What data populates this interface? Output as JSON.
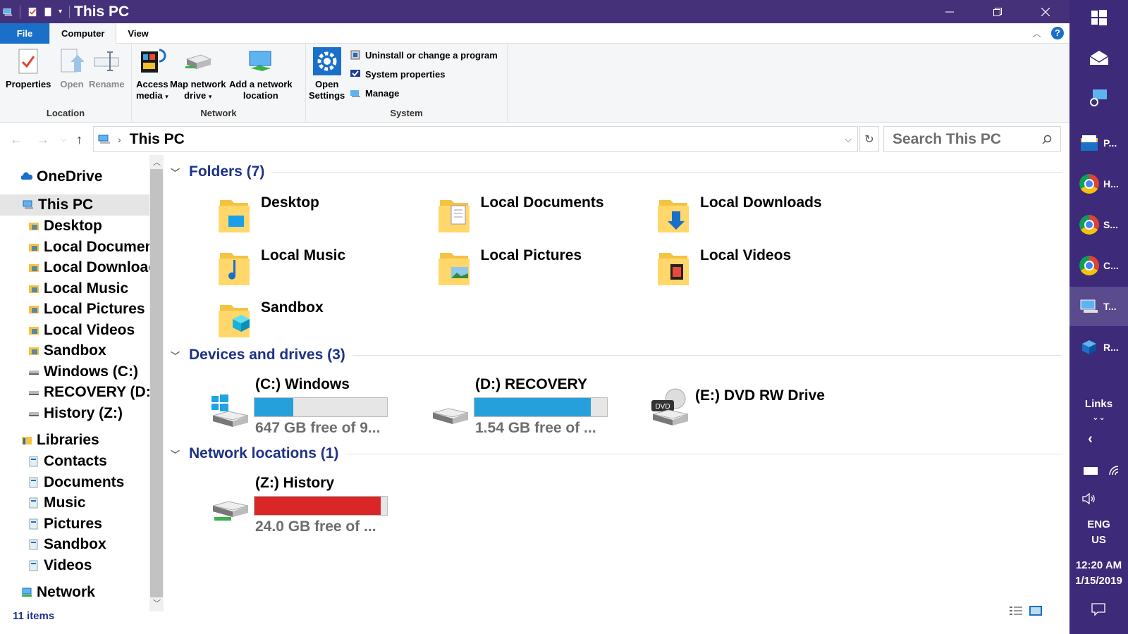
{
  "window": {
    "title": "This PC",
    "status_items": "11 items"
  },
  "ribbon_tabs": [
    "File",
    "Computer",
    "View"
  ],
  "ribbon": {
    "location": {
      "label": "Location",
      "buttons": [
        "Properties",
        "Open",
        "Rename"
      ]
    },
    "network": {
      "label": "Network",
      "access_media": [
        "Access",
        "media"
      ],
      "map_drive": [
        "Map network",
        "drive"
      ],
      "add_location": [
        "Add a network",
        "location"
      ]
    },
    "system": {
      "label": "System",
      "open_settings": [
        "Open",
        "Settings"
      ],
      "uninstall": "Uninstall or change a program",
      "properties": "System properties",
      "manage": "Manage"
    }
  },
  "address": {
    "path": "This PC",
    "search_placeholder": "Search This PC"
  },
  "nav": {
    "onedrive": "OneDrive",
    "this_pc": "This PC",
    "pc_items": [
      "Desktop",
      "Local Documents",
      "Local Downloads",
      "Local Music",
      "Local Pictures",
      "Local Videos",
      "Sandbox",
      "Windows (C:)",
      "RECOVERY (D:)",
      "History (Z:)"
    ],
    "libraries": "Libraries",
    "library_items": [
      "Contacts",
      "Documents",
      "Music",
      "Pictures",
      "Sandbox",
      "Videos"
    ],
    "network": "Network"
  },
  "sections": {
    "folders": "Folders (7)",
    "drives": "Devices and drives (3)",
    "network": "Network locations (1)"
  },
  "folders": [
    "Desktop",
    "Local Documents",
    "Local Downloads",
    "Local Music",
    "Local Pictures",
    "Local Videos",
    "Sandbox"
  ],
  "drives": [
    {
      "name": "(C:) Windows",
      "free": "647 GB free of 9...",
      "used_fraction": 0.29,
      "color": "#26a0da"
    },
    {
      "name": "(D:) RECOVERY",
      "free": "1.54 GB free of ...",
      "used_fraction": 0.88,
      "color": "#26a0da"
    },
    {
      "name": "(E:) DVD RW Drive",
      "dvd_label": "DVD"
    }
  ],
  "network_locations": [
    {
      "name": "(Z:) History",
      "free": "24.0 GB free of ...",
      "used_fraction": 0.95,
      "color": "#da2626"
    }
  ],
  "taskbar": {
    "apps": [
      "P...",
      "H...",
      "S...",
      "C...",
      "T...",
      "R..."
    ],
    "links": "Links",
    "lang": [
      "ENG",
      "US"
    ],
    "time": "12:20 AM",
    "date": "1/15/2019"
  }
}
